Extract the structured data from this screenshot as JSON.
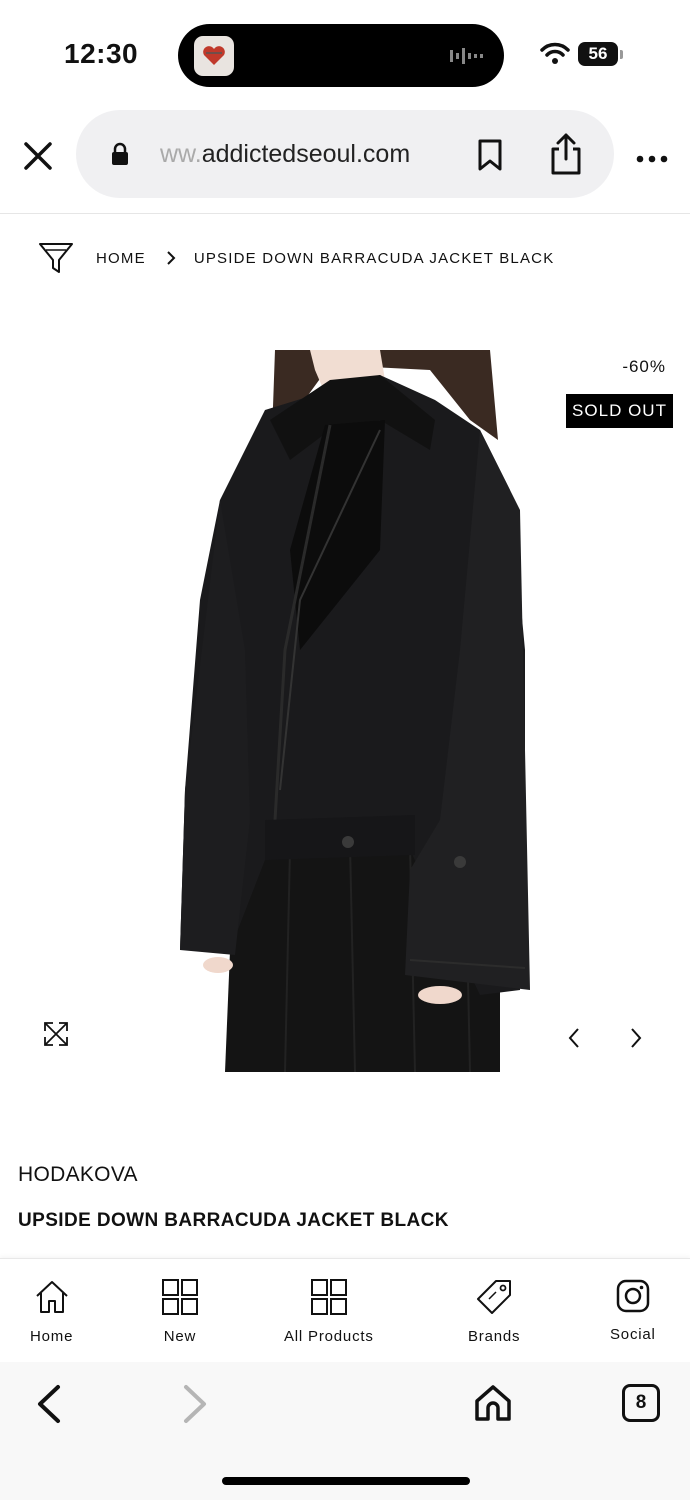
{
  "status_bar": {
    "time": "12:30",
    "battery": "56"
  },
  "browser": {
    "url_faded": "ww.",
    "url": "addictedseoul.com"
  },
  "breadcrumb": {
    "home": "HOME",
    "current": "UPSIDE DOWN BARRACUDA JACKET BLACK"
  },
  "product": {
    "discount": "-60%",
    "badge": "SOLD OUT",
    "brand": "HODAKOVA",
    "title": "UPSIDE DOWN BARRACUDA JACKET BLACK"
  },
  "bottom_nav": {
    "items": [
      {
        "label": "Home",
        "icon": "home-icon"
      },
      {
        "label": "New",
        "icon": "grid-icon"
      },
      {
        "label": "All Products",
        "icon": "grid-icon"
      },
      {
        "label": "Brands",
        "icon": "tag-icon"
      },
      {
        "label": "Social",
        "icon": "instagram-icon"
      }
    ]
  },
  "safari": {
    "tab_count": "8"
  },
  "colors": {
    "accent": "#000000",
    "url_pill": "#f0f0f2",
    "background": "#ffffff"
  }
}
